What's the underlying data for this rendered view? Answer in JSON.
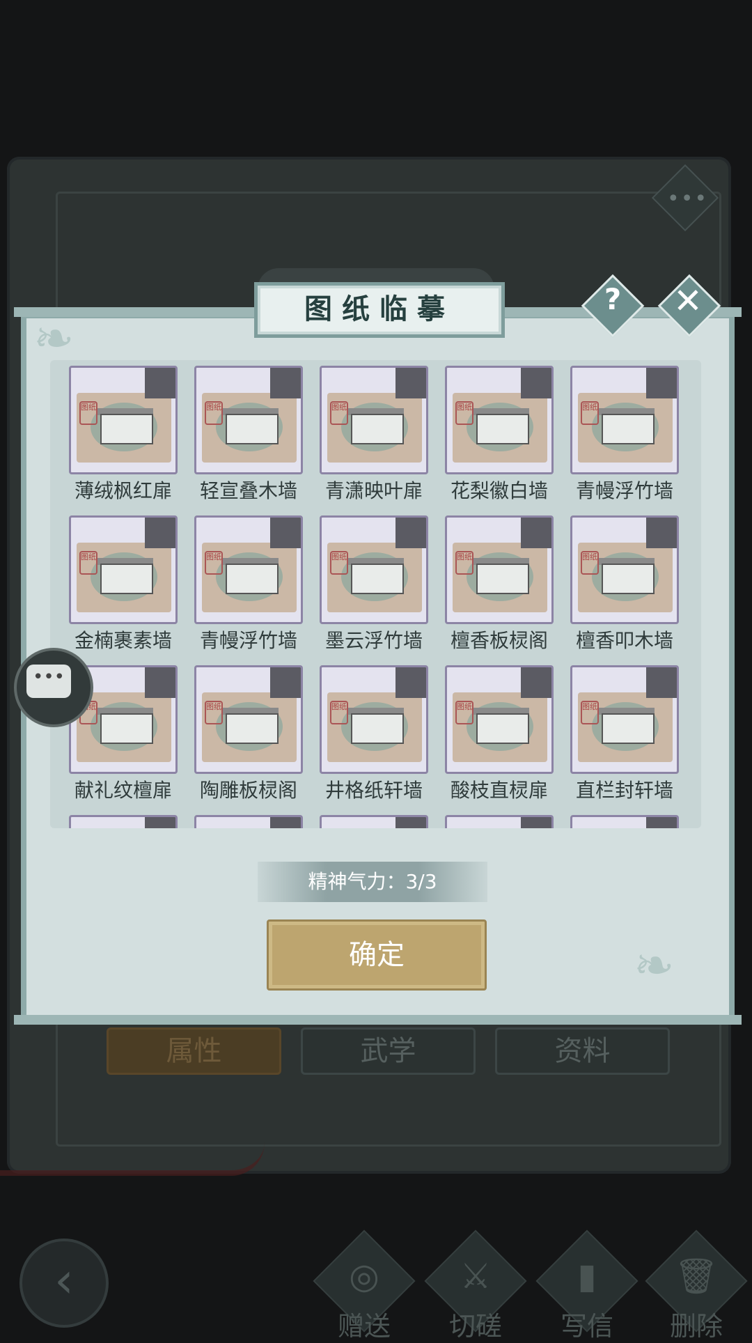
{
  "background": {
    "tabs": [
      "属性",
      "武学",
      "资料"
    ],
    "actions": [
      {
        "label": "赠送",
        "icon": "scroll-icon"
      },
      {
        "label": "切磋",
        "icon": "sword-icon"
      },
      {
        "label": "写信",
        "icon": "letter-icon"
      },
      {
        "label": "删除",
        "icon": "trash-icon"
      }
    ],
    "more_dots": "•••"
  },
  "dialog": {
    "title": "图纸临摹",
    "help_symbol": "?",
    "close_symbol": "✕",
    "stamina_text": "精神气力：3/3",
    "confirm_label": "确定"
  },
  "chat": {
    "glyph": "•••"
  },
  "blueprints": [
    {
      "name": "薄绒枫红扉"
    },
    {
      "name": "轻宣叠木墙"
    },
    {
      "name": "青潇映叶扉"
    },
    {
      "name": "花梨徽白墙"
    },
    {
      "name": "青幔浮竹墙"
    },
    {
      "name": "金楠裹素墙"
    },
    {
      "name": "青幔浮竹墙"
    },
    {
      "name": "墨云浮竹墙"
    },
    {
      "name": "檀香板棂阁"
    },
    {
      "name": "檀香叩木墙"
    },
    {
      "name": "献礼纹檀扉"
    },
    {
      "name": "陶雕板棂阁"
    },
    {
      "name": "井格纸轩墙"
    },
    {
      "name": "酸枝直棂扉"
    },
    {
      "name": "直栏封轩墙"
    }
  ],
  "seal_text": "图纸"
}
